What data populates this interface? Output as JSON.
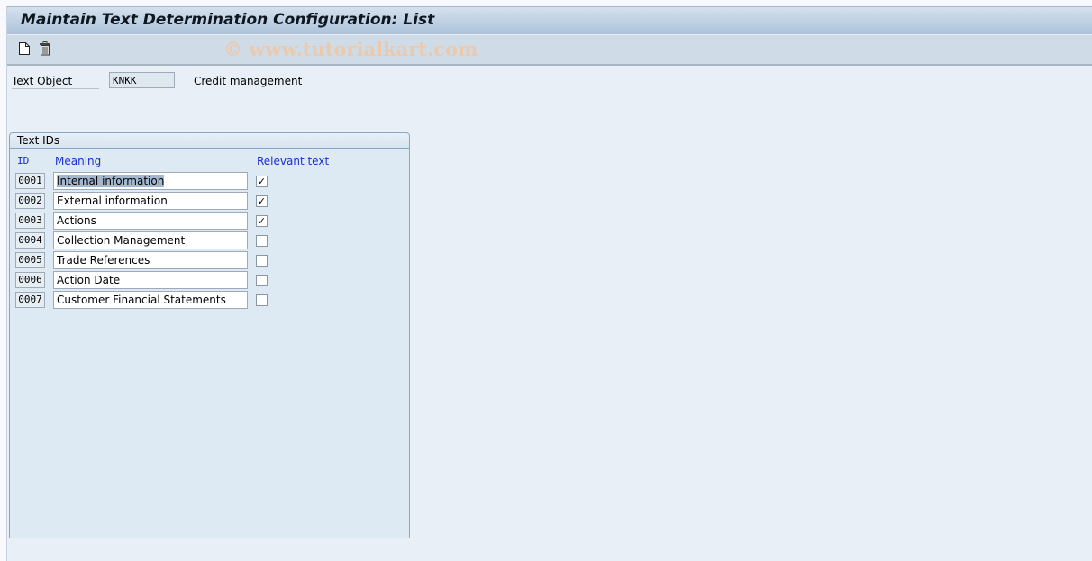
{
  "window": {
    "title": "Maintain Text Determination Configuration: List"
  },
  "toolbar": {
    "new_icon": "new-document-icon",
    "delete_icon": "trash-icon",
    "watermark": "© www.tutorialkart.com"
  },
  "header": {
    "text_object_label": "Text Object",
    "text_object_value": "KNKK",
    "text_object_desc": "Credit management"
  },
  "group": {
    "title": "Text IDs",
    "columns": {
      "id": "ID",
      "meaning": "Meaning",
      "relevant": "Relevant text"
    },
    "rows": [
      {
        "id": "0001",
        "meaning": "Internal information",
        "relevant": true,
        "selected": true
      },
      {
        "id": "0002",
        "meaning": "External information",
        "relevant": true
      },
      {
        "id": "0003",
        "meaning": "Actions",
        "relevant": true
      },
      {
        "id": "0004",
        "meaning": "Collection Management",
        "relevant": false
      },
      {
        "id": "0005",
        "meaning": "Trade References",
        "relevant": false
      },
      {
        "id": "0006",
        "meaning": "Action Date",
        "relevant": false
      },
      {
        "id": "0007",
        "meaning": "Customer Financial Statements",
        "relevant": false
      }
    ]
  }
}
